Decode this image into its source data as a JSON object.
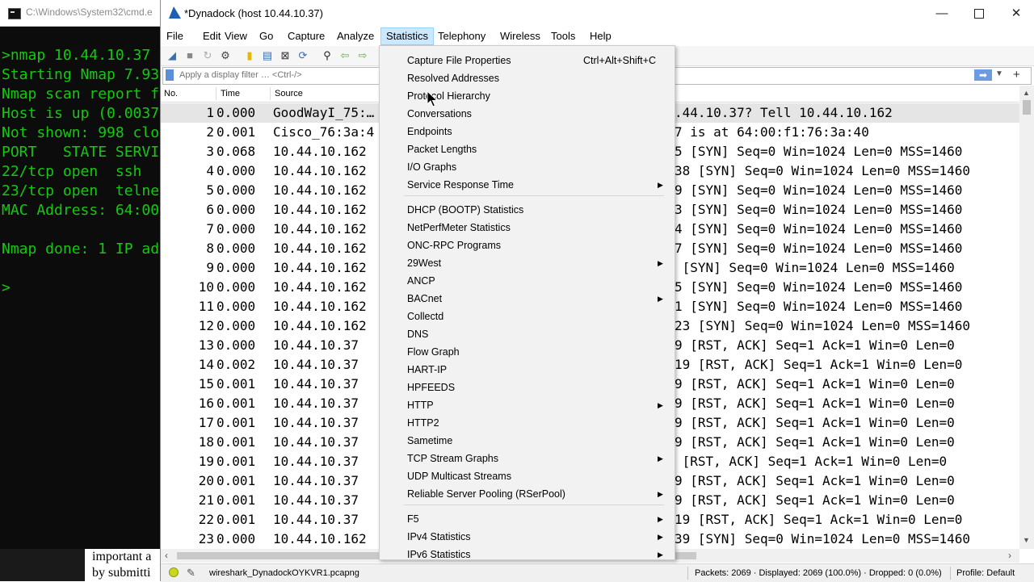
{
  "cmd": {
    "title": "C:\\Windows\\System32\\cmd.e",
    "lines": [
      ">nmap 10.44.10.37",
      "Starting Nmap 7.93",
      "Nmap scan report f",
      "Host is up (0.0037",
      "Not shown: 998 clo",
      "PORT   STATE SERVI",
      "22/tcp open  ssh",
      "23/tcp open  telne",
      "MAC Address: 64:00",
      "",
      "Nmap done: 1 IP ad",
      "",
      ">"
    ],
    "colors": {
      "text": "#13c90f",
      "background": "#0c0c0c"
    }
  },
  "document_snippet": {
    "line1": "important a",
    "line2": "by submitti"
  },
  "wireshark": {
    "title": "*Dynadock (host 10.44.10.37)",
    "window_controls": {
      "minimize": "—",
      "maximize": "",
      "close": "✕"
    },
    "menu": [
      "File",
      "Edit",
      "View",
      "Go",
      "Capture",
      "Analyze",
      "Statistics",
      "Telephony",
      "Wireless",
      "Tools",
      "Help"
    ],
    "active_menu": "Statistics",
    "filter": {
      "placeholder": "Apply a display filter … <Ctrl-/>",
      "apply_icon": "➡",
      "add_icon": "+"
    },
    "columns": {
      "no": "No.",
      "time": "Time",
      "source": "Source"
    },
    "packets": [
      {
        "no": "1",
        "time": "0.000",
        "source": "GoodWayI_75:…",
        "info": ".44.10.37? Tell 10.44.10.162"
      },
      {
        "no": "2",
        "time": "0.001",
        "source": "Cisco_76:3a:4",
        "info": "7 is at 64:00:f1:76:3a:40"
      },
      {
        "no": "3",
        "time": "0.068",
        "source": "10.44.10.162",
        "info": "5 [SYN] Seq=0 Win=1024 Len=0 MSS=1460"
      },
      {
        "no": "4",
        "time": "0.000",
        "source": "10.44.10.162",
        "info": "38 [SYN] Seq=0 Win=1024 Len=0 MSS=1460"
      },
      {
        "no": "5",
        "time": "0.000",
        "source": "10.44.10.162",
        "info": "9 [SYN] Seq=0 Win=1024 Len=0 MSS=1460"
      },
      {
        "no": "6",
        "time": "0.000",
        "source": "10.44.10.162",
        "info": "3 [SYN] Seq=0 Win=1024 Len=0 MSS=1460"
      },
      {
        "no": "7",
        "time": "0.000",
        "source": "10.44.10.162",
        "info": "4 [SYN] Seq=0 Win=1024 Len=0 MSS=1460"
      },
      {
        "no": "8",
        "time": "0.000",
        "source": "10.44.10.162",
        "info": "7 [SYN] Seq=0 Win=1024 Len=0 MSS=1460"
      },
      {
        "no": "9",
        "time": "0.000",
        "source": "10.44.10.162",
        "info": " [SYN] Seq=0 Win=1024 Len=0 MSS=1460"
      },
      {
        "no": "10",
        "time": "0.000",
        "source": "10.44.10.162",
        "info": "5 [SYN] Seq=0 Win=1024 Len=0 MSS=1460"
      },
      {
        "no": "11",
        "time": "0.000",
        "source": "10.44.10.162",
        "info": "1 [SYN] Seq=0 Win=1024 Len=0 MSS=1460"
      },
      {
        "no": "12",
        "time": "0.000",
        "source": "10.44.10.162",
        "info": "23 [SYN] Seq=0 Win=1024 Len=0 MSS=1460"
      },
      {
        "no": "13",
        "time": "0.000",
        "source": "10.44.10.37",
        "info": "9 [RST, ACK] Seq=1 Ack=1 Win=0 Len=0"
      },
      {
        "no": "14",
        "time": "0.002",
        "source": "10.44.10.37",
        "info": "19 [RST, ACK] Seq=1 Ack=1 Win=0 Len=0"
      },
      {
        "no": "15",
        "time": "0.001",
        "source": "10.44.10.37",
        "info": "9 [RST, ACK] Seq=1 Ack=1 Win=0 Len=0"
      },
      {
        "no": "16",
        "time": "0.001",
        "source": "10.44.10.37",
        "info": "9 [RST, ACK] Seq=1 Ack=1 Win=0 Len=0"
      },
      {
        "no": "17",
        "time": "0.001",
        "source": "10.44.10.37",
        "info": "9 [RST, ACK] Seq=1 Ack=1 Win=0 Len=0"
      },
      {
        "no": "18",
        "time": "0.001",
        "source": "10.44.10.37",
        "info": "9 [RST, ACK] Seq=1 Ack=1 Win=0 Len=0"
      },
      {
        "no": "19",
        "time": "0.001",
        "source": "10.44.10.37",
        "info": " [RST, ACK] Seq=1 Ack=1 Win=0 Len=0"
      },
      {
        "no": "20",
        "time": "0.001",
        "source": "10.44.10.37",
        "info": "9 [RST, ACK] Seq=1 Ack=1 Win=0 Len=0"
      },
      {
        "no": "21",
        "time": "0.001",
        "source": "10.44.10.37",
        "info": "9 [RST, ACK] Seq=1 Ack=1 Win=0 Len=0"
      },
      {
        "no": "22",
        "time": "0.001",
        "source": "10.44.10.37",
        "info": "19 [RST, ACK] Seq=1 Ack=1 Win=0 Len=0"
      },
      {
        "no": "23",
        "time": "0.000",
        "source": "10.44.10.162",
        "info": "39 [SYN] Seq=0 Win=1024 Len=0 MSS=1460"
      }
    ],
    "statusbar": {
      "file": "wireshark_DynadockOYKVR1.pcapng",
      "packets": "Packets: 2069 · Displayed: 2069 (100.0%) · Dropped: 0 (0.0%)",
      "profile": "Profile: Default"
    }
  },
  "statistics_menu": {
    "items": [
      {
        "label": "Capture File Properties",
        "shortcut": "Ctrl+Alt+Shift+C",
        "submenu": false
      },
      {
        "label": "Resolved Addresses",
        "submenu": false
      },
      {
        "label": "Protocol Hierarchy",
        "submenu": false
      },
      {
        "label": "Conversations",
        "submenu": false
      },
      {
        "label": "Endpoints",
        "submenu": false
      },
      {
        "label": "Packet Lengths",
        "submenu": false
      },
      {
        "label": "I/O Graphs",
        "submenu": false
      },
      {
        "label": "Service Response Time",
        "submenu": true
      },
      {
        "separator": true
      },
      {
        "label": "DHCP (BOOTP) Statistics",
        "submenu": false
      },
      {
        "label": "NetPerfMeter Statistics",
        "submenu": false
      },
      {
        "label": "ONC-RPC Programs",
        "submenu": false
      },
      {
        "label": "29West",
        "submenu": true
      },
      {
        "label": "ANCP",
        "submenu": false
      },
      {
        "label": "BACnet",
        "submenu": true
      },
      {
        "label": "Collectd",
        "submenu": false
      },
      {
        "label": "DNS",
        "submenu": false
      },
      {
        "label": "Flow Graph",
        "submenu": false
      },
      {
        "label": "HART-IP",
        "submenu": false
      },
      {
        "label": "HPFEEDS",
        "submenu": false
      },
      {
        "label": "HTTP",
        "submenu": true
      },
      {
        "label": "HTTP2",
        "submenu": false
      },
      {
        "label": "Sametime",
        "submenu": false
      },
      {
        "label": "TCP Stream Graphs",
        "submenu": true
      },
      {
        "label": "UDP Multicast Streams",
        "submenu": false
      },
      {
        "label": "Reliable Server Pooling (RSerPool)",
        "submenu": true
      },
      {
        "separator": true
      },
      {
        "label": "F5",
        "submenu": true
      },
      {
        "label": "IPv4 Statistics",
        "submenu": true
      },
      {
        "label": "IPv6 Statistics",
        "submenu": true
      }
    ]
  }
}
